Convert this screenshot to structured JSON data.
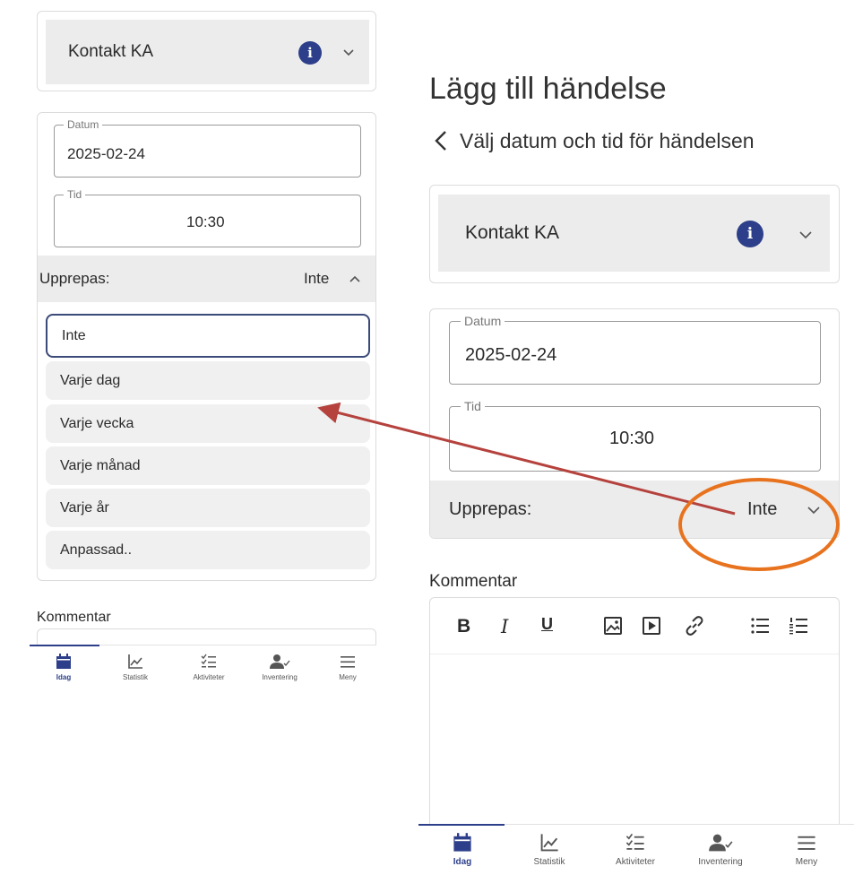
{
  "left": {
    "category": "Kontakt KA",
    "date_legend": "Datum",
    "date_value": "2025-02-24",
    "time_legend": "Tid",
    "time_value": "10:30",
    "repeat_label": "Upprepas:",
    "repeat_value": "Inte",
    "repeat_options": [
      "Inte",
      "Varje dag",
      "Varje vecka",
      "Varje månad",
      "Varje år",
      "Anpassad.."
    ],
    "comment_label": "Kommentar"
  },
  "right": {
    "page_title": "Lägg till händelse",
    "subtitle": "Välj datum och tid för händelsen",
    "category": "Kontakt KA",
    "date_legend": "Datum",
    "date_value": "2025-02-24",
    "time_legend": "Tid",
    "time_value": "10:30",
    "repeat_label": "Upprepas:",
    "repeat_value": "Inte",
    "comment_label": "Kommentar",
    "toolbar": {
      "bold": "B",
      "italic": "I",
      "underline": "U"
    }
  },
  "nav": {
    "items": [
      {
        "label": "Idag",
        "icon": "calendar-icon"
      },
      {
        "label": "Statistik",
        "icon": "chart-icon"
      },
      {
        "label": "Aktiviteter",
        "icon": "checklist-icon"
      },
      {
        "label": "Inventering",
        "icon": "person-check-icon"
      },
      {
        "label": "Meny",
        "icon": "menu-icon"
      }
    ]
  },
  "colors": {
    "accent": "#2d3f8a",
    "arrow": "#b5423d",
    "highlight_circle": "#e8731f",
    "card_gray": "#ececec"
  }
}
